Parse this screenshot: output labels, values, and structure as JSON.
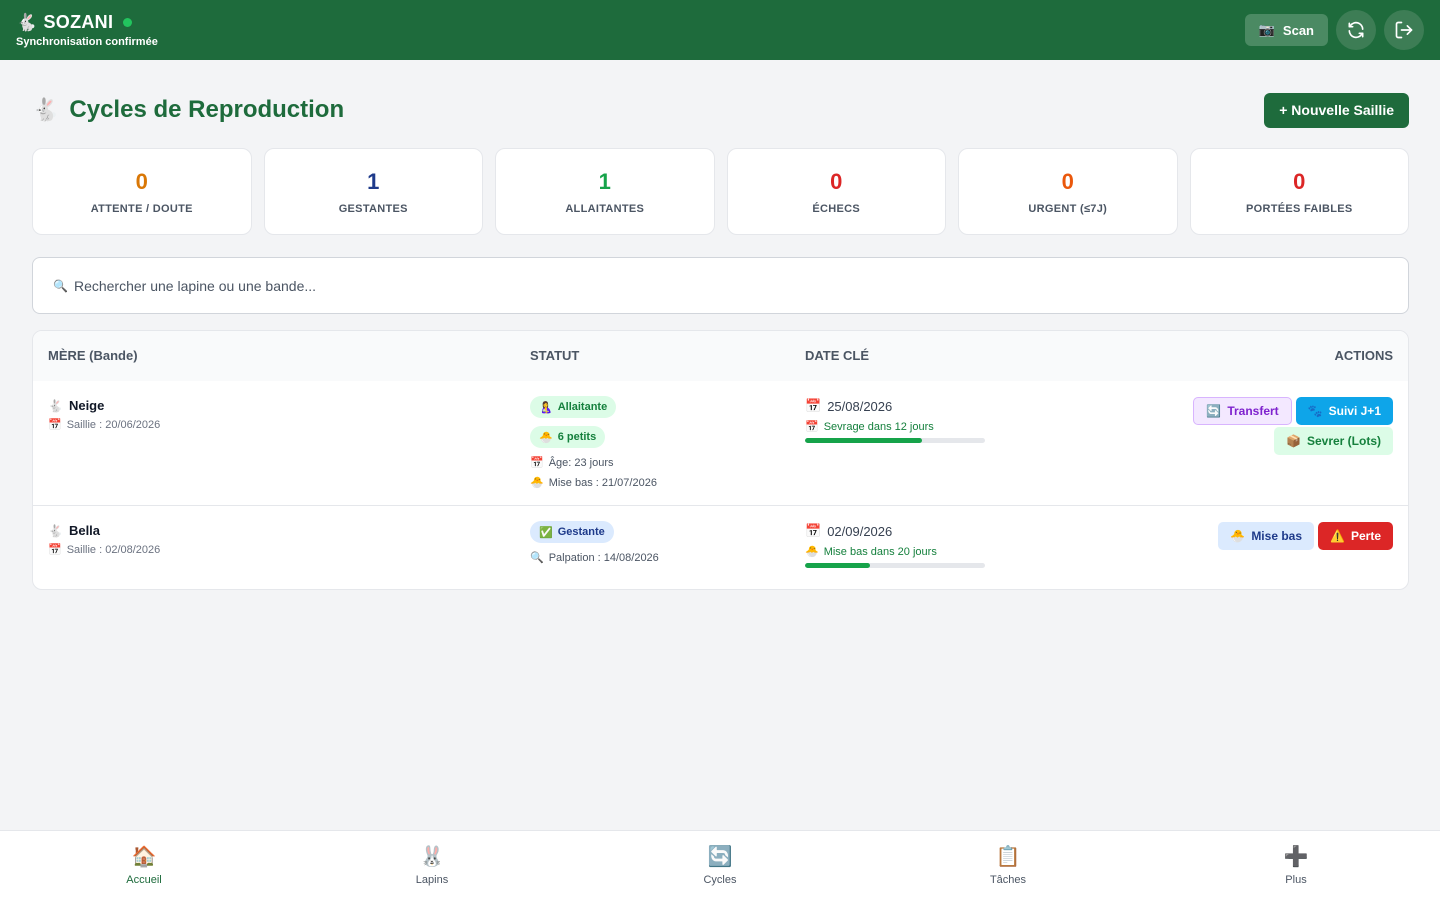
{
  "header": {
    "brand_icon": "🐇",
    "app_name": "SOZANI",
    "sync_status": "Synchronisation confirmée",
    "status_dot_color": "#22c55e",
    "scan_icon": "📷",
    "scan_label": "Scan"
  },
  "page": {
    "title_icon": "🐇",
    "title": "Cycles de Reproduction",
    "new_button": "+ Nouvelle Saillie"
  },
  "stats": [
    {
      "value": "0",
      "label": "ATTENTE / DOUTE",
      "color": "#d97706"
    },
    {
      "value": "1",
      "label": "GESTANTES",
      "color": "#1e3a8a"
    },
    {
      "value": "1",
      "label": "ALLAITANTES",
      "color": "#16a34a"
    },
    {
      "value": "0",
      "label": "ÉCHECS",
      "color": "#dc2626"
    },
    {
      "value": "0",
      "label": "URGENT (≤7J)",
      "color": "#ea580c"
    },
    {
      "value": "0",
      "label": "PORTÉES FAIBLES",
      "color": "#dc2626"
    }
  ],
  "search": {
    "icon": "🔍",
    "placeholder": "Rechercher une lapine ou une bande..."
  },
  "table": {
    "headers": {
      "mere": "MÈRE (Bande)",
      "statut": "STATUT",
      "date": "DATE CLÉ",
      "actions": "ACTIONS"
    },
    "rows": [
      {
        "name_icon": "🐇",
        "name": "Neige",
        "saillie_icon": "📅",
        "saillie": "Saillie : 20/06/2026",
        "badges": [
          {
            "icon": "🤱",
            "label": "Allaitante"
          },
          {
            "icon": "🐣",
            "label": "6 petits"
          }
        ],
        "infos": [
          {
            "icon": "📅",
            "text": "Âge: 23 jours"
          },
          {
            "icon": "🐣",
            "text": "Mise bas : 21/07/2026"
          }
        ],
        "date_icon": "📅",
        "date": "25/08/2026",
        "note_icon": "📅",
        "note": "Sevrage dans 12 jours",
        "progress": 0.65,
        "actions": {
          "transfert": "Transfert",
          "suivi": "Suivi J+1",
          "sevrer": "Sevrer (Lots)"
        }
      },
      {
        "name_icon": "🐇",
        "name": "Bella",
        "saillie_icon": "📅",
        "saillie": "Saillie : 02/08/2026",
        "badges": [
          {
            "icon": "✅",
            "label": "Gestante"
          }
        ],
        "infos": [
          {
            "icon": "🔍",
            "text": "Palpation : 14/08/2026"
          }
        ],
        "date_icon": "📅",
        "date": "02/09/2026",
        "note_icon": "🐣",
        "note": "Mise bas dans 20 jours",
        "progress": 0.36,
        "actions": {
          "misebas": "Mise bas",
          "perte": "Perte"
        }
      }
    ]
  },
  "action_icons": {
    "transfert": "🔄",
    "suivi": "🐾",
    "sevrer": "📦",
    "misebas": "🐣",
    "perte": "⚠️"
  },
  "nav": [
    {
      "icon": "🏠",
      "label": "Accueil",
      "active": true
    },
    {
      "icon": "🐰",
      "label": "Lapins",
      "active": false
    },
    {
      "icon": "🔄",
      "label": "Cycles",
      "active": false
    },
    {
      "icon": "📋",
      "label": "Tâches",
      "active": false
    },
    {
      "icon": "➕",
      "label": "Plus",
      "active": false
    }
  ]
}
